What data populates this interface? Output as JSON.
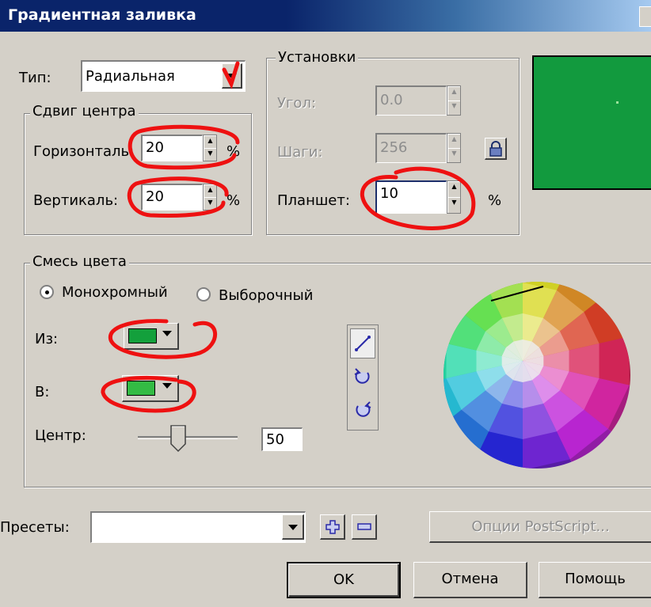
{
  "title": "Градиентная заливка",
  "type_label": "Тип:",
  "type_value": "Радиальная",
  "center_offset": {
    "legend": "Сдвиг центра",
    "horizontal_label": "Горизонталь:",
    "horizontal_value": "20",
    "vertical_label": "Вертикаль:",
    "vertical_value": "20",
    "unit": "%"
  },
  "settings": {
    "legend": "Установки",
    "angle_label": "Угол:",
    "angle_value": "0.0",
    "steps_label": "Шаги:",
    "steps_value": "256",
    "edge_pad_label": "Планшет:",
    "edge_pad_value": "10",
    "unit": "%"
  },
  "preview": {
    "color": "#129a3e"
  },
  "color_blend": {
    "legend": "Смесь цвета",
    "mono_label": "Монохромный",
    "custom_label": "Выборочный",
    "selected": "mono",
    "from_label": "Из:",
    "from_color": "#13a03c",
    "to_label": "В:",
    "to_color": "#33bb44",
    "mid_label": "Центр:",
    "mid_value": "50",
    "mid_fraction": 0.5
  },
  "presets_label": "Пресеты:",
  "presets_value": "",
  "postscript_button": "Опции PostScript...",
  "ok_button": "OK",
  "cancel_button": "Отмена",
  "help_button": "Помощь",
  "annotation_marks": {
    "color": "#ee1111"
  }
}
